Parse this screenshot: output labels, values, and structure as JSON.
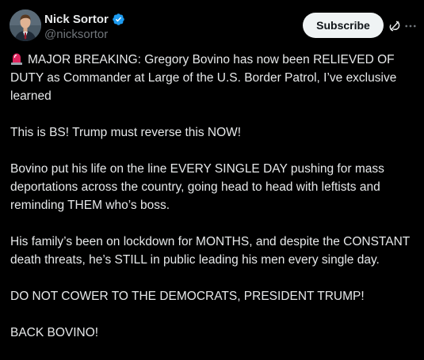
{
  "author": {
    "display_name": "Nick Sortor",
    "handle": "@nicksortor",
    "verified": true
  },
  "header": {
    "subscribe_label": "Subscribe",
    "grok_icon": "grok-icon",
    "more_icon": "more-icon"
  },
  "post": {
    "siren_icon": "rotating-light-emoji",
    "paragraphs": [
      "MAJOR BREAKING: Gregory Bovino has now been RELIEVED OF DUTY as Commander at Large of the U.S. Border Patrol, I’ve exclusive learned",
      "This is BS! Trump must reverse this NOW!",
      "Bovino put his life on the line EVERY SINGLE DAY pushing for mass deportations across the country, going head to head with leftists and reminding THEM who’s boss.",
      "His family’s been on lockdown for MONTHS, and despite the CONSTANT death threats, he’s STILL in public leading his men every single day.",
      "DO NOT COWER TO THE DEMOCRATS, PRESIDENT TRUMP!",
      "BACK BOVINO!"
    ]
  },
  "colors": {
    "background": "#000000",
    "text": "#e7e9ea",
    "secondary_text": "#71767b",
    "verified_blue": "#1d9bf0",
    "subscribe_bg": "#eff3f4",
    "siren_red": "#e0245e"
  }
}
